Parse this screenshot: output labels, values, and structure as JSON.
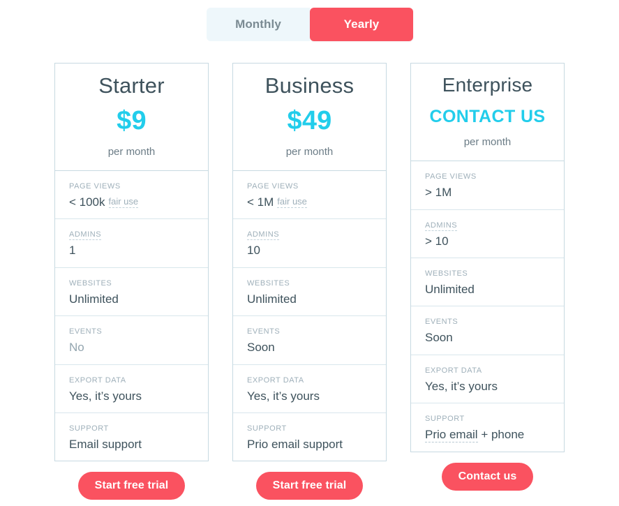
{
  "billing_toggle": {
    "monthly_label": "Monthly",
    "yearly_label": "Yearly",
    "selected": "Yearly"
  },
  "colors": {
    "accent_red": "#fa5260",
    "accent_cyan": "#22cdeb",
    "card_border": "#c7d9e1",
    "row_border": "#d8e6ec",
    "title": "#3e525c",
    "label": "#9fb0ba",
    "muted_value": "#93a5af",
    "toggle_inactive_bg": "#eef7fb"
  },
  "feature_labels": {
    "page_views": "PAGE VIEWS",
    "admins": "ADMINS",
    "websites": "WEBSITES",
    "events": "EVENTS",
    "export_data": "EXPORT DATA",
    "support": "SUPPORT"
  },
  "plans": [
    {
      "name": "Starter",
      "price": "$9",
      "period": "per month",
      "page_views": "< 100k",
      "page_views_tag": "fair use",
      "admins": "1",
      "websites": "Unlimited",
      "events": "No",
      "export_data": "Yes, it’s yours",
      "support": "Email support",
      "support_suffix": "",
      "cta": "Start free trial"
    },
    {
      "name": "Business",
      "price": "$49",
      "period": "per month",
      "page_views": "< 1M",
      "page_views_tag": "fair use",
      "admins": "10",
      "websites": "Unlimited",
      "events": "Soon",
      "export_data": "Yes, it’s yours",
      "support": "Prio email support",
      "support_suffix": "",
      "cta": "Start free trial"
    },
    {
      "name": "Enterprise",
      "price": "CONTACT US",
      "period": "per month",
      "page_views": "> 1M",
      "page_views_tag": "",
      "admins": "> 10",
      "websites": "Unlimited",
      "events": "Soon",
      "export_data": "Yes, it’s yours",
      "support": "Prio email",
      "support_suffix": " + phone",
      "cta": "Contact us"
    }
  ]
}
